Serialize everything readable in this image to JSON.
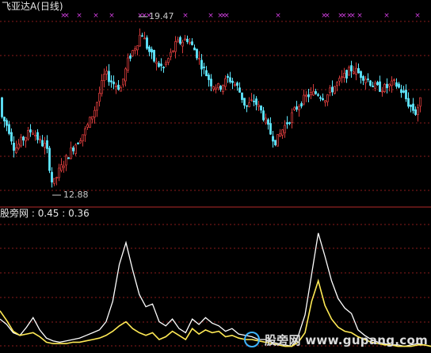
{
  "main_panel": {
    "title": "飞亚达A",
    "period": "(日线)",
    "high_label": "19.47",
    "low_label": "12.88"
  },
  "indicator_panel": {
    "name": "股旁网",
    "value1": "0.45",
    "value2": "0.36"
  },
  "watermark": "股旁网 www.gupang.com",
  "colors": {
    "background": "#000000",
    "up": "#d23a3a",
    "down": "#5fe8ff",
    "grid": "#8a1c1c",
    "marker": "#d23ee0",
    "line_white": "#ffffff",
    "line_yellow": "#ffea55",
    "divider": "#b42a2a"
  },
  "chart_data": {
    "type": "candlestick",
    "price_range": [
      12.5,
      20.0
    ],
    "markers": "magenta x at top of price panel",
    "indicator_series": [
      {
        "name": "白线",
        "values": [
          0.22,
          0.18,
          0.12,
          0.1,
          0.16,
          0.23,
          0.14,
          0.08,
          0.06,
          0.05,
          0.06,
          0.07,
          0.08,
          0.1,
          0.12,
          0.14,
          0.2,
          0.35,
          0.62,
          0.78,
          0.58,
          0.4,
          0.31,
          0.33,
          0.2,
          0.17,
          0.22,
          0.15,
          0.12,
          0.22,
          0.18,
          0.23,
          0.19,
          0.17,
          0.13,
          0.15,
          0.11,
          0.1,
          0.09,
          0.07,
          0.07,
          0.05,
          0.04,
          0.03,
          0.02,
          0.1,
          0.25,
          0.55,
          0.85,
          0.68,
          0.5,
          0.37,
          0.3,
          0.26,
          0.14,
          0.1,
          0.07,
          0.05,
          0.04,
          0.03,
          0.03,
          0.02,
          0.03,
          0.04,
          0.03,
          0.02
        ]
      },
      {
        "name": "黄线",
        "values": [
          0.28,
          0.21,
          0.13,
          0.1,
          0.11,
          0.12,
          0.09,
          0.05,
          0.04,
          0.04,
          0.04,
          0.05,
          0.05,
          0.06,
          0.07,
          0.08,
          0.1,
          0.13,
          0.17,
          0.2,
          0.15,
          0.12,
          0.1,
          0.12,
          0.07,
          0.09,
          0.13,
          0.1,
          0.07,
          0.15,
          0.11,
          0.14,
          0.12,
          0.13,
          0.09,
          0.1,
          0.08,
          0.07,
          0.07,
          0.06,
          0.05,
          0.04,
          0.03,
          0.02,
          0.02,
          0.05,
          0.12,
          0.35,
          0.5,
          0.32,
          0.22,
          0.16,
          0.13,
          0.12,
          0.09,
          0.07,
          0.05,
          0.04,
          0.03,
          0.03,
          0.02,
          0.02,
          0.02,
          0.03,
          0.03,
          0.02
        ]
      }
    ]
  }
}
